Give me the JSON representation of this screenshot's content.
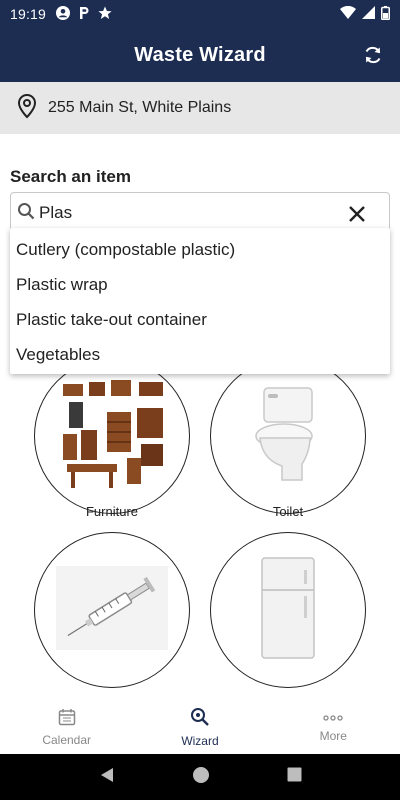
{
  "status_bar": {
    "time": "19:19",
    "left_icons": [
      "account-circle-icon",
      "parking-icon",
      "star-icon"
    ],
    "right_icons": [
      "wifi-icon",
      "signal-icon",
      "battery-icon"
    ]
  },
  "app_bar": {
    "title": "Waste Wizard",
    "action_icon": "refresh-icon"
  },
  "address": {
    "icon": "location-pin-icon",
    "text": "255 Main St, White Plains"
  },
  "search": {
    "label": "Search an item",
    "value": "Plas",
    "icon": "search-icon",
    "clear_icon": "close-icon",
    "suggestions": [
      "Cutlery (compostable plastic)",
      "Plastic wrap",
      "Plastic take-out container",
      "Vegetables"
    ]
  },
  "tiles": [
    {
      "label": "Furniture",
      "icon": "furniture-image"
    },
    {
      "label": "Toilet",
      "icon": "toilet-image"
    },
    {
      "label": "",
      "icon": "syringe-image"
    },
    {
      "label": "",
      "icon": "refrigerator-image"
    }
  ],
  "bottom_nav": {
    "items": [
      {
        "label": "Calendar",
        "icon": "calendar-icon",
        "active": false
      },
      {
        "label": "Wizard",
        "icon": "wizard-search-icon",
        "active": true
      },
      {
        "label": "More",
        "icon": "more-dots-icon",
        "active": false
      }
    ]
  },
  "colors": {
    "primary": "#1d2d52",
    "address_bg": "#e7e7e7",
    "inactive_nav": "#888888"
  }
}
